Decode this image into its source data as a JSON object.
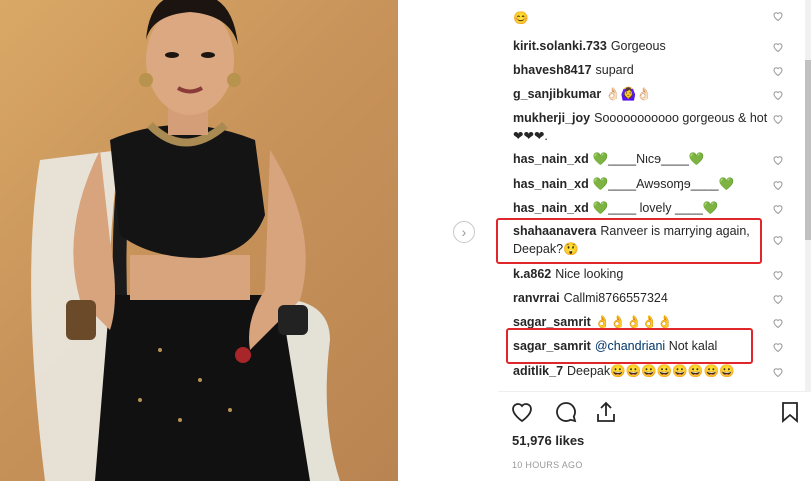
{
  "post": {
    "likes": "51,976 likes",
    "time": "10 HOURS AGO"
  },
  "comments": [
    {
      "user": "",
      "text": "😊"
    },
    {
      "user": "kirit.solanki.733",
      "text": "Gorgeous"
    },
    {
      "user": "bhavesh8417",
      "text": "supard"
    },
    {
      "user": "g_sanjibkumar",
      "text": "👌🏻🙆‍♀️👌🏻"
    },
    {
      "user": "mukherji_joy",
      "text": "Sooooooooooo gorgeous & hot ❤❤❤."
    },
    {
      "user": "has_nain_xd",
      "text": "💚____Nιcɘ____💚"
    },
    {
      "user": "has_nain_xd",
      "text": "💚____Awɘsoɱɘ____💚"
    },
    {
      "user": "has_nain_xd",
      "text": "💚____ lovely ____💚"
    },
    {
      "user": "shahaanavera",
      "text": "Ranveer is marrying again, Deepak?😲"
    },
    {
      "user": "k.a862",
      "text": "Nice looking"
    },
    {
      "user": "ranvrrai",
      "text": "Callmi8766557324"
    },
    {
      "user": "sagar_samrit",
      "text": "👌👌👌👌👌"
    },
    {
      "user": "sagar_samrit",
      "mention": "@chandriani",
      "text": "Not kalal"
    },
    {
      "user": "aditlik_7",
      "text": "Deepak😀😀😀😀😀😀😀😀"
    }
  ],
  "colors": {
    "highlight": "#e0262b",
    "heart_green": "#2ecc40",
    "heart_red": "#c0161b"
  },
  "icons": {
    "next": "chevron-right-icon",
    "like": "heart-icon",
    "comment": "comment-icon",
    "share": "share-icon",
    "save": "bookmark-icon"
  }
}
